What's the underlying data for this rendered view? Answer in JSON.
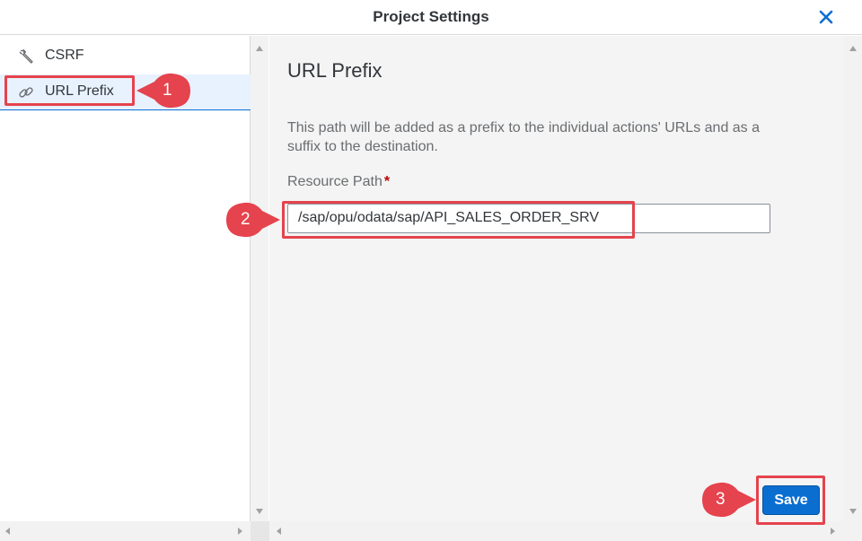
{
  "dialog": {
    "title": "Project Settings",
    "close_icon": "close-icon"
  },
  "sidebar": {
    "items": [
      {
        "label": "CSRF",
        "icon": "wrench-icon",
        "selected": false
      },
      {
        "label": "URL Prefix",
        "icon": "link-icon",
        "selected": true
      }
    ]
  },
  "main": {
    "heading": "URL Prefix",
    "description": "This path will be added as a prefix to the individual actions' URLs and as a suffix to the destination.",
    "field_label": "Resource Path",
    "required_marker": "*",
    "resource_path_value": "/sap/opu/odata/sap/API_SALES_ORDER_SRV",
    "save_label": "Save"
  },
  "callouts": [
    "1",
    "2",
    "3"
  ],
  "colors": {
    "accent": "#0a6ed1",
    "callout": "#e5434d",
    "selected_bg": "#e8f2ff"
  }
}
